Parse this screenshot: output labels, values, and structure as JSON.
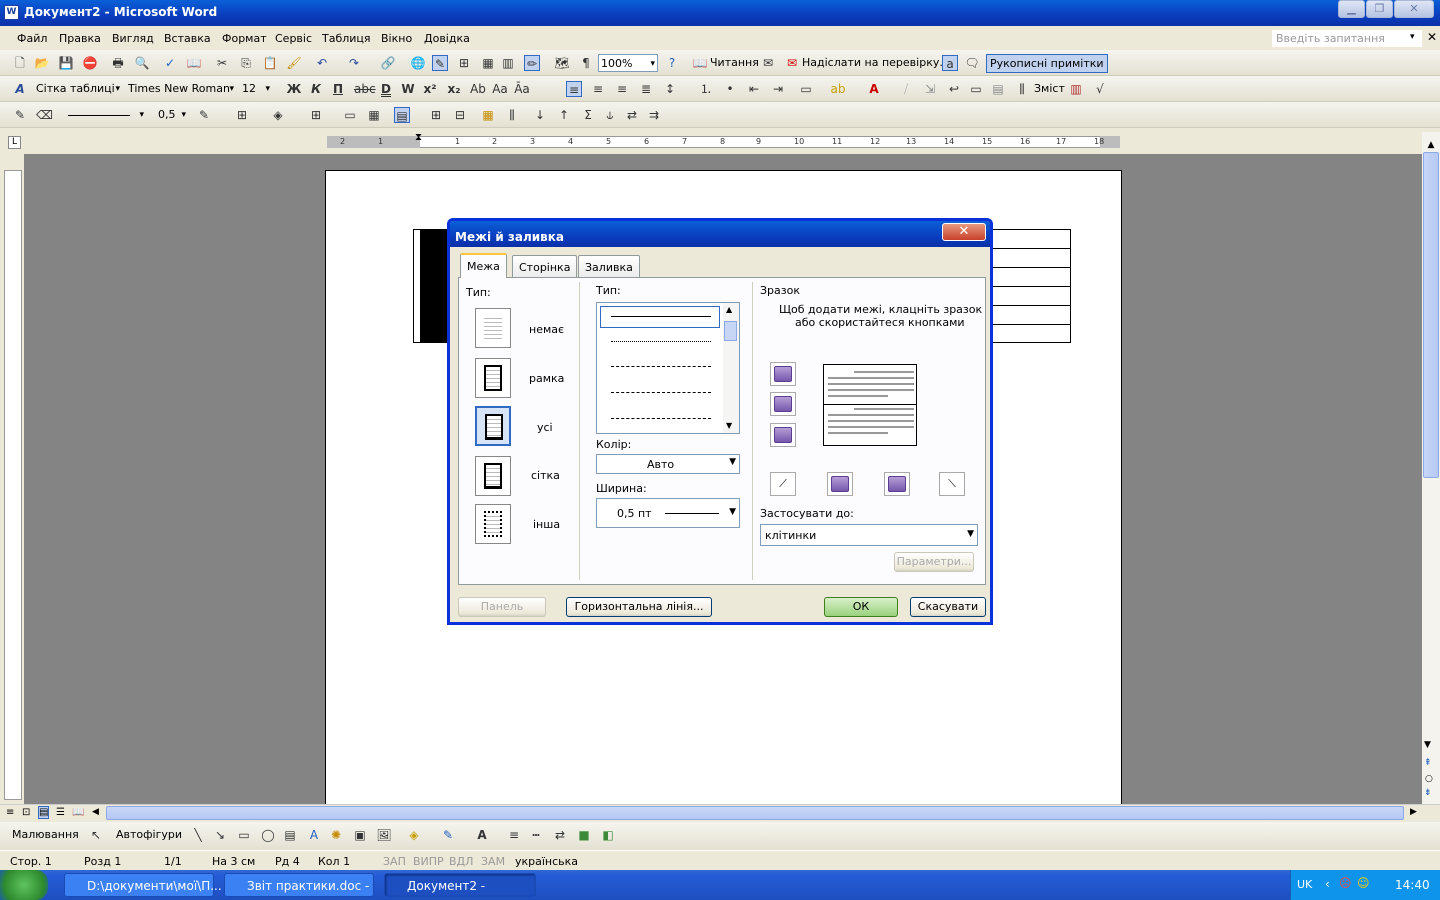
{
  "window": {
    "title": "Документ2 - Microsoft Word",
    "icon": "W"
  },
  "menu": {
    "items": [
      "Файл",
      "Правка",
      "Вигляд",
      "Вставка",
      "Формат",
      "Сервіс",
      "Таблиця",
      "Вікно",
      "Довідка"
    ],
    "ask_placeholder": "Введіть запитання"
  },
  "toolbar1": {
    "zoom": "100%",
    "reading": "Читання",
    "send_review": "Надіслати на перевірку...",
    "handwritten": "Рукописні примітки"
  },
  "toolbar2": {
    "style": "Сітка таблиці",
    "font": "Times New Roman",
    "size": "12",
    "toc": "Зміст"
  },
  "toolbar3": {
    "line_width": "0,5"
  },
  "ruler": {
    "numbers": [
      "2",
      "1",
      "1",
      "2",
      "3",
      "4",
      "5",
      "6",
      "7",
      "8",
      "9",
      "10",
      "11",
      "12",
      "13",
      "14",
      "15",
      "16",
      "17",
      "18"
    ]
  },
  "dialog": {
    "title": "Межі й заливка",
    "tabs": [
      "Межа",
      "Сторінка",
      "Заливка"
    ],
    "type_label": "Тип:",
    "settings": [
      "немає",
      "рамка",
      "усі",
      "сітка",
      "інша"
    ],
    "style_label": "Тип:",
    "color_label": "Колір:",
    "color_value": "Авто",
    "width_label": "Ширина:",
    "width_value": "0,5 пт",
    "preview_label": "Зразок",
    "preview_hint_1": "Щоб додати межі, клацніть зразок",
    "preview_hint_2": "або скористайтеся кнопками",
    "apply_label": "Застосувати до:",
    "apply_value": "клітинки",
    "options_button": "Параметри...",
    "panel_button": "Панель",
    "hline_button": "Горизонтальна лінія...",
    "ok_button": "ОК",
    "cancel_button": "Скасувати"
  },
  "drawbar": {
    "drawing": "Малювання",
    "autoshapes": "Автофігури"
  },
  "status": {
    "page": "Стор. 1",
    "section": "Розд 1",
    "pages": "1/1",
    "at": "На 3 см",
    "line": "Рд 4",
    "col": "Кол 1",
    "rec": "ЗАП",
    "trk": "ВИПР",
    "ext": "ВДЛ",
    "ovr": "ЗАМ",
    "lang": "українська"
  },
  "taskbar": {
    "tasks": [
      "D:\\документи\\мої\\П...",
      "Звіт практики.doc - ...",
      "Документ2 - Micros..."
    ],
    "lang": "UK",
    "clock": "14:40"
  }
}
